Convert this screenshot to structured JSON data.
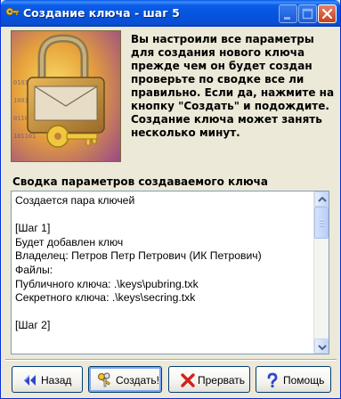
{
  "window": {
    "title": "Создание ключа - шаг 5"
  },
  "intro_text": "Вы настроили все параметры для создания нового ключа прежде чем он будет создан проверьте по сводке все ли правильно. Если да, нажмите на кнопку \"Создать\" и подождите. Создание ключа может занять несколько минут.",
  "summary": {
    "label": "Сводка параметров создаваемого ключа",
    "lines": [
      "Создается пара ключей",
      "",
      "[Шаг 1]",
      "Будет добавлен ключ",
      "Владелец:  Петров Петр Петрович (ИК Петрович)",
      "Файлы:",
      "Публичного ключа:  .\\keys\\pubring.txk",
      "Секретного ключа:  .\\keys\\secring.txk",
      "",
      "[Шаг 2]",
      ""
    ]
  },
  "buttons": {
    "back": "Назад",
    "create": "Создать!",
    "abort": "Прервать",
    "help": "Помощь"
  },
  "icons": {
    "app": "key-icon",
    "back": "double-left-arrow-icon",
    "create": "keys-icon",
    "abort": "red-x-icon",
    "help": "question-mark-icon"
  },
  "colors": {
    "titlebar": "#0A58E8",
    "window_bg": "#ECE9D8",
    "close_button": "#C6401C"
  }
}
